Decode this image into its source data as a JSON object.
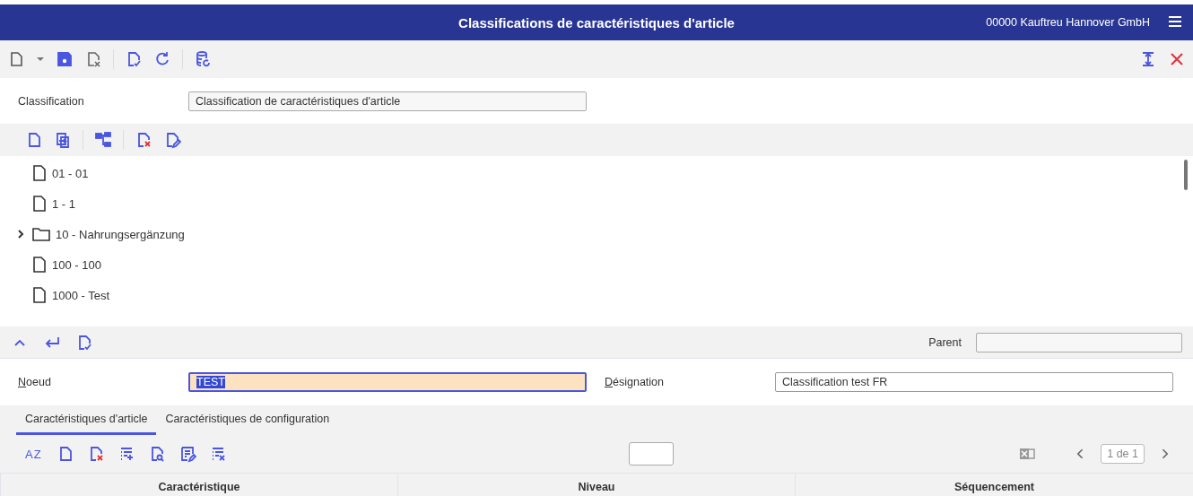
{
  "header": {
    "title": "Classifications de caractéristiques d'article",
    "company": "00000  Kauftreu Hannover GmbH"
  },
  "classification": {
    "label": "Classification",
    "value": "Classification de caractéristiques d'article"
  },
  "tree": {
    "items": [
      {
        "kind": "file",
        "label": "01 - 01"
      },
      {
        "kind": "file",
        "label": "1 - 1"
      },
      {
        "kind": "folder",
        "label": "10 - Nahrungsergänzung",
        "expanded": false
      },
      {
        "kind": "file",
        "label": "100 - 100"
      },
      {
        "kind": "file",
        "label": "1000 - Test"
      }
    ]
  },
  "sort_button": "AZ",
  "detail": {
    "parent_label": "Parent",
    "node_label": "Noeud",
    "node_value": "TEST",
    "designation_label": "Désignation",
    "designation_value": "Classification test FR"
  },
  "tabs": [
    {
      "label": "Caractéristiques d'article",
      "selected": true
    },
    {
      "label": "Caractéristiques de configuration",
      "selected": false
    }
  ],
  "pager": "1 de 1",
  "table": {
    "columns": [
      "Caractéristique",
      "Niveau",
      "Séquencement"
    ]
  }
}
